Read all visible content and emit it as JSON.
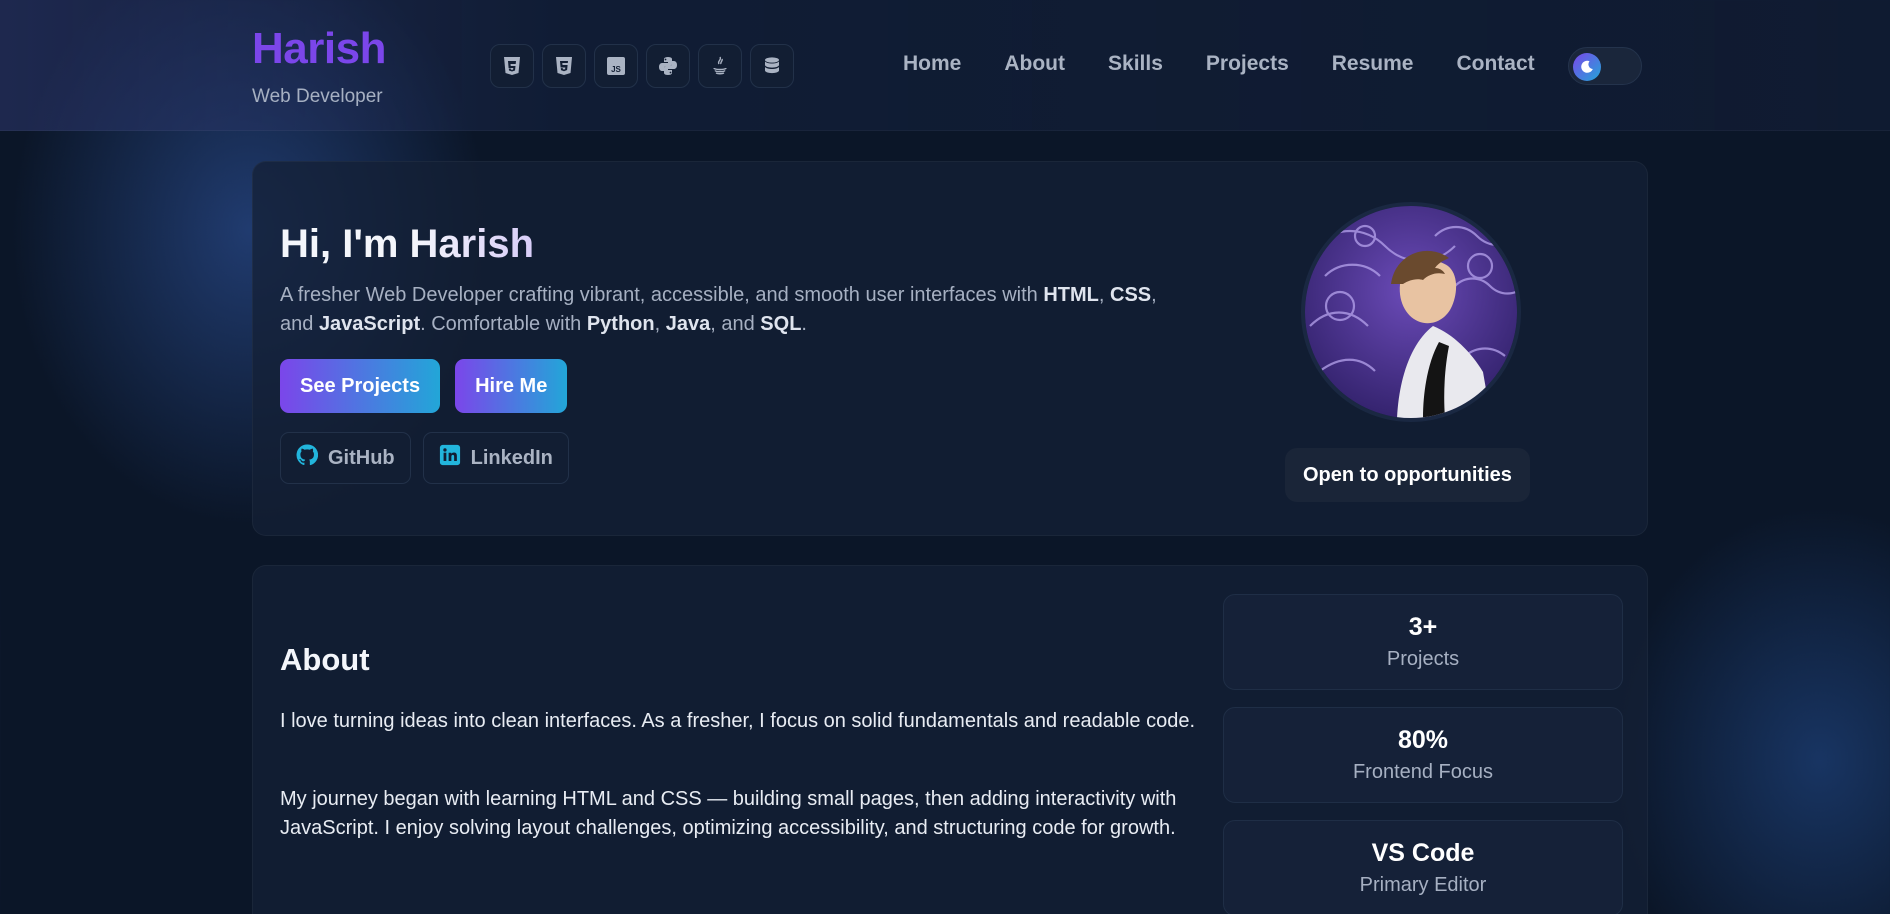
{
  "brand": {
    "name": "Harish",
    "subtitle": "Web Developer"
  },
  "tech_icons": [
    "html5-icon",
    "css3-icon",
    "javascript-icon",
    "python-icon",
    "java-icon",
    "database-icon"
  ],
  "nav": {
    "items": [
      {
        "label": "Home"
      },
      {
        "label": "About"
      },
      {
        "label": "Skills"
      },
      {
        "label": "Projects"
      },
      {
        "label": "Resume"
      },
      {
        "label": "Contact"
      }
    ]
  },
  "theme_toggle": {
    "icon": "moon-icon"
  },
  "hero": {
    "greeting": "Hi, I'm ",
    "name": "Harish",
    "description": {
      "intro": "A fresher Web Developer crafting vibrant, accessible, and smooth user interfaces with ",
      "html": "HTML",
      "sep1": ", ",
      "css": "CSS",
      "sep2": ", and ",
      "js": "JavaScript",
      "mid": ". Comfortable with ",
      "python": "Python",
      "sep3": ", ",
      "java": "Java",
      "sep4": ", and ",
      "sql": "SQL",
      "end": "."
    },
    "primary_buttons": [
      "See Projects",
      "Hire Me"
    ],
    "social": [
      {
        "label": "GitHub",
        "icon": "github-icon"
      },
      {
        "label": "LinkedIn",
        "icon": "linkedin-icon"
      }
    ],
    "badge": "Open to opportunities"
  },
  "about": {
    "title": "About",
    "paragraphs": [
      "I love turning ideas into clean interfaces. As a fresher, I focus on solid fundamentals and readable code.",
      "My journey began with learning HTML and CSS — building small pages, then adding interactivity with JavaScript. I enjoy solving layout challenges, optimizing accessibility, and structuring code for growth."
    ],
    "stats": [
      {
        "value": "3+",
        "label": "Projects"
      },
      {
        "value": "80%",
        "label": "Frontend Focus"
      },
      {
        "value": "VS Code",
        "label": "Primary Editor"
      }
    ]
  },
  "colors": {
    "background": "#0b1628",
    "brand_purple": "#7b46ea",
    "accent_cyan": "#22a6d8",
    "card": "#142036",
    "muted_text": "#a6b0c2"
  }
}
